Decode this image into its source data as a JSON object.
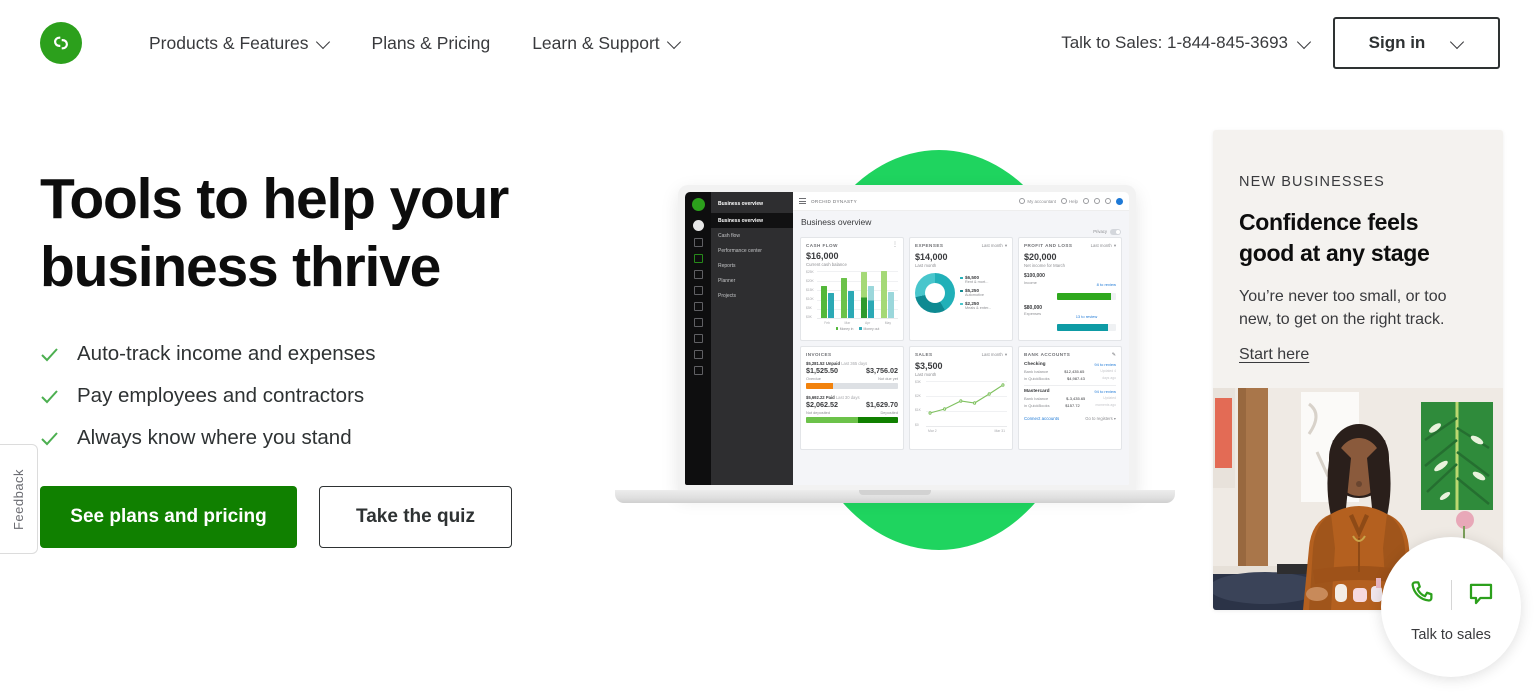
{
  "header": {
    "logo_name": "quickbooks-logo",
    "nav": [
      {
        "label": "Products & Features",
        "has_caret": true
      },
      {
        "label": "Plans & Pricing",
        "has_caret": false
      },
      {
        "label": "Learn & Support",
        "has_caret": true
      }
    ],
    "sales_phone": "Talk to Sales: 1-844-845-3693",
    "signin_label": "Sign in"
  },
  "hero": {
    "title_line1": "Tools to help your",
    "title_line2": "business thrive",
    "bullets": [
      "Auto-track income and expenses",
      "Pay employees and contractors",
      "Always know where you stand"
    ],
    "primary_cta": "See plans and pricing",
    "secondary_cta": "Take the quiz"
  },
  "feedback_tab": {
    "label": "Feedback"
  },
  "promo": {
    "eyebrow": "NEW BUSINESSES",
    "title_line1": "Confidence feels",
    "title_line2": "good at any stage",
    "text_line1": "You’re never too small, or too",
    "text_line2": "new, to get on the right track.",
    "link": "Start here"
  },
  "talk_widget": {
    "label": "Talk to sales"
  },
  "colors": {
    "brand_green": "#2CA01C",
    "bright_green": "#1FD45F",
    "button_green": "#108000",
    "link_blue": "#1E79D6",
    "teal": "#21B0B8",
    "orange": "#F2820D",
    "promo_bg": "#F4F2EF",
    "text_dark": "#2E3233"
  },
  "app": {
    "sidebar_title": "Business overview",
    "menu": [
      "Business overview",
      "Cash flow",
      "Performance center",
      "Reports",
      "Planner",
      "Projects"
    ],
    "company": "ORCHID DYNASTY",
    "page_title": "Business overview",
    "topbar": {
      "my_accountant": "My accountant",
      "help": "Help",
      "privacy": "Privacy"
    },
    "cards": {
      "cash_flow": {
        "title": "CASH FLOW",
        "kpi": "$16,000",
        "kpi_label": "Current cash balance",
        "chart_data": {
          "type": "bar",
          "title": "Cash flow",
          "categories": [
            "Feb",
            "Mar",
            "Apr",
            "May"
          ],
          "series": [
            {
              "name": "Money in",
              "values": [
                17000,
                21000,
                24000,
                24500
              ]
            },
            {
              "name": "Money out",
              "values": [
                13000,
                14000,
                17000,
                13500
              ]
            }
          ],
          "yticks": [
            "$25K",
            "$20K",
            "$15K",
            "$10K",
            "$5K",
            "$0K"
          ],
          "ylim": [
            0,
            25000
          ],
          "grid": true,
          "legend": [
            "Money in",
            "Money out"
          ],
          "legend_position": "bottom",
          "colors": [
            "#53B83A",
            "#2CA9B5"
          ]
        }
      },
      "expenses": {
        "title": "EXPENSES",
        "period": "Last month",
        "kpi": "$14,000",
        "kpi_label": "Last month",
        "chart_data": {
          "type": "pie",
          "title": "Expenses",
          "labels": [
            "Rent & mort...",
            "Automotive",
            "Meals & enter..."
          ],
          "values": [
            6500,
            5250,
            2250
          ],
          "value_labels": [
            "$6,500",
            "$5,250",
            "$2,250"
          ],
          "colors": [
            "#21B0B8",
            "#0E8A92",
            "#48C6CC"
          ],
          "legend_position": "right"
        }
      },
      "profit_loss": {
        "title": "PROFIT AND LOSS",
        "period": "Last month",
        "kpi": "$20,000",
        "kpi_label": "Net income for March",
        "rows": [
          {
            "amount": "$100,000",
            "category": "Income",
            "review": "8 to review",
            "pct": 92,
            "color": "#2FA81E"
          },
          {
            "amount": "$80,000",
            "category": "Expenses",
            "review": "13 to review",
            "pct": 86,
            "color": "#0E9BA5"
          }
        ]
      },
      "invoices": {
        "title": "INVOICES",
        "unpaid_head_amount": "$5,281.52",
        "unpaid_head_word": "Unpaid",
        "unpaid_head_period": "Last 365 days",
        "overdue_amount": "$1,525.50",
        "overdue_label": "Overdue",
        "notdue_amount": "$3,756.02",
        "notdue_label": "Not due yet",
        "overdue_pct": 29,
        "paid_head_amount": "$5,692.22",
        "paid_head_word": "Paid",
        "paid_head_period": "Last 30 days",
        "notdeposited_amount": "$2,062.52",
        "notdeposited_label": "Not deposited",
        "deposited_amount": "$1,629.70",
        "deposited_label": "Deposited",
        "notdeposited_pct": 56
      },
      "sales": {
        "title": "SALES",
        "period": "Last month",
        "kpi": "$3,500",
        "kpi_label": "Last month",
        "chart_data": {
          "type": "line",
          "title": "Sales",
          "x": [
            "Mar 2",
            "Mar 8",
            "Mar 14",
            "Mar 20",
            "Mar 26",
            "Mar 31"
          ],
          "values": [
            1100,
            1450,
            2100,
            1950,
            2500,
            3050
          ],
          "yticks": [
            "$3K",
            "$2K",
            "$1K",
            "$0"
          ],
          "ylim": [
            0,
            3500
          ],
          "xlabel_first": "Mar 2",
          "xlabel_last": "Mar 31",
          "color": "#7FC15F",
          "grid": true
        }
      },
      "bank_accounts": {
        "title": "BANK ACCOUNTS",
        "accounts": [
          {
            "name": "Checking",
            "review": "94 to review",
            "bank_balance_label": "Bank balance",
            "bank_balance": "$12,435.65",
            "qb_label": "in QuickBooks",
            "qb_balance": "$4,987.43",
            "note1": "Updated 4",
            "note2": "days ago"
          },
          {
            "name": "Mastercard",
            "review": "94 to review",
            "bank_balance_label": "Bank balance",
            "bank_balance": "$-3,435.65",
            "qb_label": "in QuickBooks",
            "qb_balance": "$157.72",
            "note1": "Updated",
            "note2": "moments ago"
          }
        ],
        "connect_link": "Connect accounts",
        "registers_link": "Go to registers"
      }
    }
  }
}
